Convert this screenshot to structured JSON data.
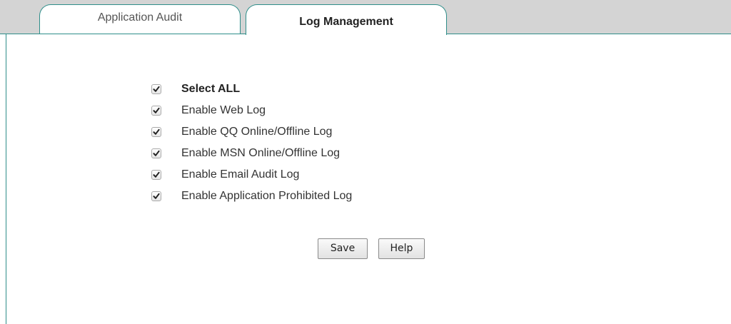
{
  "tabs": [
    {
      "label": "Application Audit",
      "active": false
    },
    {
      "label": "Log Management",
      "active": true
    }
  ],
  "options": [
    {
      "label": "Select ALL",
      "checked": true
    },
    {
      "label": "Enable Web Log",
      "checked": true
    },
    {
      "label": "Enable QQ Online/Offline Log",
      "checked": true
    },
    {
      "label": "Enable MSN Online/Offline Log",
      "checked": true
    },
    {
      "label": "Enable Email Audit Log",
      "checked": true
    },
    {
      "label": "Enable Application Prohibited Log",
      "checked": true
    }
  ],
  "buttons": {
    "save_label": "Save",
    "help_label": "Help"
  },
  "colors": {
    "accent": "#2f8e8a",
    "tabbar_background": "#d4d4d4"
  }
}
